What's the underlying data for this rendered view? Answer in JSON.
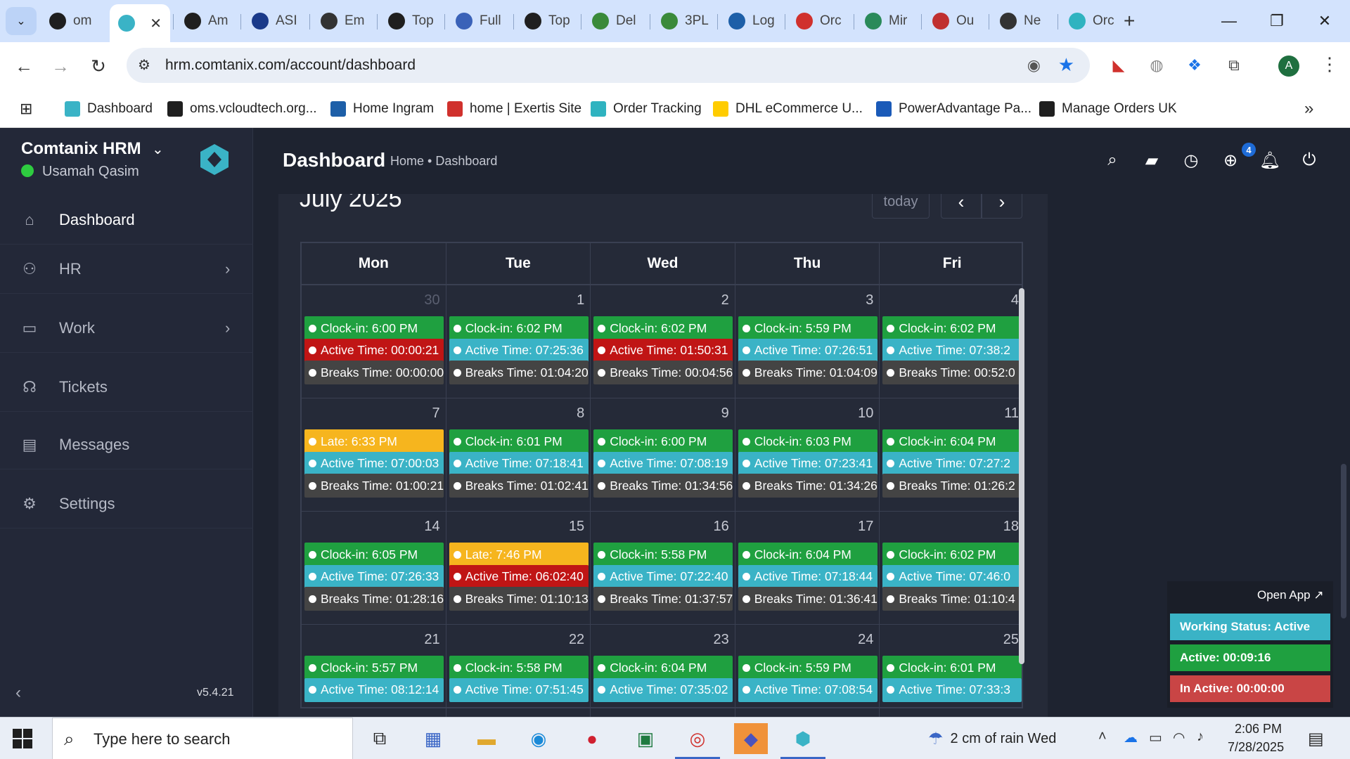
{
  "browser": {
    "tabs": [
      {
        "label": "om",
        "icon": "vcloud-icon",
        "color": "#1f1f1f"
      },
      {
        "label": "",
        "icon": "comtanix-icon",
        "color": "#3ab3c6",
        "active": true
      },
      {
        "label": "Am",
        "icon": "amazon-icon",
        "color": "#1f1f1f"
      },
      {
        "label": "ASI",
        "icon": "asi-icon",
        "color": "#1a3a8a"
      },
      {
        "label": "Em",
        "icon": "openai-icon",
        "color": "#333"
      },
      {
        "label": "Top",
        "icon": "top-icon",
        "color": "#1f1f1f"
      },
      {
        "label": "Full",
        "icon": "box-icon",
        "color": "#3a62b8"
      },
      {
        "label": "Top",
        "icon": "top-icon",
        "color": "#1f1f1f"
      },
      {
        "label": "Del",
        "icon": "truck-icon",
        "color": "#3a8a3a"
      },
      {
        "label": "3PL",
        "icon": "truck-icon",
        "color": "#3a8a3a"
      },
      {
        "label": "Log",
        "icon": "log-icon",
        "color": "#1d5fa8"
      },
      {
        "label": "Orc",
        "icon": "exertis-icon",
        "color": "#d0312d"
      },
      {
        "label": "Mir",
        "icon": "mir-icon",
        "color": "#2a8a5a"
      },
      {
        "label": "Ou",
        "icon": "shein-icon",
        "color": "#c03030"
      },
      {
        "label": "Ne",
        "icon": "openai-icon",
        "color": "#333"
      },
      {
        "label": "Orc",
        "icon": "order-icon",
        "color": "#2fb3c0"
      }
    ],
    "url": "hrm.comtanix.com/account/dashboard",
    "profile_initial": "A",
    "bookmarks": [
      {
        "label": "Dashboard",
        "color": "#3ab3c6"
      },
      {
        "label": "oms.vcloudtech.org...",
        "color": "#1f1f1f"
      },
      {
        "label": "Home Ingram",
        "color": "#1d5fa8"
      },
      {
        "label": "home | Exertis Site",
        "color": "#d0312d"
      },
      {
        "label": "Order Tracking",
        "color": "#2fb3c0"
      },
      {
        "label": "DHL eCommerce U...",
        "color": "#ffcc00"
      },
      {
        "label": "PowerAdvantage Pa...",
        "color": "#1a5ab8"
      },
      {
        "label": "Manage Orders UK",
        "color": "#1f1f1f"
      }
    ]
  },
  "app": {
    "brand": "Comtanix HRM",
    "user": "Usamah Qasim",
    "version": "v5.4.21",
    "nav": [
      {
        "label": "Dashboard",
        "icon": "home-icon",
        "active": true,
        "chevron": false
      },
      {
        "label": "HR",
        "icon": "users-icon",
        "chevron": true
      },
      {
        "label": "Work",
        "icon": "briefcase-icon",
        "chevron": true
      },
      {
        "label": "Tickets",
        "icon": "headset-icon",
        "chevron": false
      },
      {
        "label": "Messages",
        "icon": "message-icon",
        "chevron": false
      },
      {
        "label": "Settings",
        "icon": "gear-icon",
        "chevron": false
      }
    ],
    "page_title": "Dashboard",
    "breadcrumb": "Home • Dashboard",
    "notification_count": "4"
  },
  "calendar": {
    "title": "July 2025",
    "today_label": "today",
    "days_of_week": [
      "Mon",
      "Tue",
      "Wed",
      "Thu",
      "Fri"
    ],
    "weeks": [
      {
        "days": [
          {
            "num": "30",
            "muted": true,
            "events": [
              [
                "green",
                "Clock-in: 6:00 PM"
              ],
              [
                "red",
                "Active Time: 00:00:21"
              ],
              [
                "gray",
                "Breaks Time: 00:00:00"
              ]
            ]
          },
          {
            "num": "1",
            "events": [
              [
                "green",
                "Clock-in: 6:02 PM"
              ],
              [
                "cyan",
                "Active Time: 07:25:36"
              ],
              [
                "gray",
                "Breaks Time: 01:04:20"
              ]
            ]
          },
          {
            "num": "2",
            "events": [
              [
                "green",
                "Clock-in: 6:02 PM"
              ],
              [
                "red",
                "Active Time: 01:50:31"
              ],
              [
                "gray",
                "Breaks Time: 00:04:56"
              ]
            ]
          },
          {
            "num": "3",
            "events": [
              [
                "green",
                "Clock-in: 5:59 PM"
              ],
              [
                "cyan",
                "Active Time: 07:26:51"
              ],
              [
                "gray",
                "Breaks Time: 01:04:09"
              ]
            ]
          },
          {
            "num": "4",
            "events": [
              [
                "green",
                "Clock-in: 6:02 PM"
              ],
              [
                "cyan",
                "Active Time: 07:38:2"
              ],
              [
                "gray",
                "Breaks Time: 00:52:0"
              ]
            ]
          }
        ]
      },
      {
        "days": [
          {
            "num": "7",
            "events": [
              [
                "yellow",
                "Late: 6:33 PM"
              ],
              [
                "cyan",
                "Active Time: 07:00:03"
              ],
              [
                "gray",
                "Breaks Time: 01:00:21"
              ]
            ]
          },
          {
            "num": "8",
            "events": [
              [
                "green",
                "Clock-in: 6:01 PM"
              ],
              [
                "cyan",
                "Active Time: 07:18:41"
              ],
              [
                "gray",
                "Breaks Time: 01:02:41"
              ]
            ]
          },
          {
            "num": "9",
            "events": [
              [
                "green",
                "Clock-in: 6:00 PM"
              ],
              [
                "cyan",
                "Active Time: 07:08:19"
              ],
              [
                "gray",
                "Breaks Time: 01:34:56"
              ]
            ]
          },
          {
            "num": "10",
            "events": [
              [
                "green",
                "Clock-in: 6:03 PM"
              ],
              [
                "cyan",
                "Active Time: 07:23:41"
              ],
              [
                "gray",
                "Breaks Time: 01:34:26"
              ]
            ]
          },
          {
            "num": "11",
            "events": [
              [
                "green",
                "Clock-in: 6:04 PM"
              ],
              [
                "cyan",
                "Active Time: 07:27:2"
              ],
              [
                "gray",
                "Breaks Time: 01:26:2"
              ]
            ]
          }
        ]
      },
      {
        "days": [
          {
            "num": "14",
            "events": [
              [
                "green",
                "Clock-in: 6:05 PM"
              ],
              [
                "cyan",
                "Active Time: 07:26:33"
              ],
              [
                "gray",
                "Breaks Time: 01:28:16"
              ]
            ]
          },
          {
            "num": "15",
            "events": [
              [
                "yellow",
                "Late: 7:46 PM"
              ],
              [
                "red",
                "Active Time: 06:02:40"
              ],
              [
                "gray",
                "Breaks Time: 01:10:13"
              ]
            ]
          },
          {
            "num": "16",
            "events": [
              [
                "green",
                "Clock-in: 5:58 PM"
              ],
              [
                "cyan",
                "Active Time: 07:22:40"
              ],
              [
                "gray",
                "Breaks Time: 01:37:57"
              ]
            ]
          },
          {
            "num": "17",
            "events": [
              [
                "green",
                "Clock-in: 6:04 PM"
              ],
              [
                "cyan",
                "Active Time: 07:18:44"
              ],
              [
                "gray",
                "Breaks Time: 01:36:41"
              ]
            ]
          },
          {
            "num": "18",
            "events": [
              [
                "green",
                "Clock-in: 6:02 PM"
              ],
              [
                "cyan",
                "Active Time: 07:46:0"
              ],
              [
                "gray",
                "Breaks Time: 01:10:4"
              ]
            ]
          }
        ]
      },
      {
        "days": [
          {
            "num": "21",
            "events": [
              [
                "green",
                "Clock-in: 5:57 PM"
              ],
              [
                "cyan",
                "Active Time: 08:12:14"
              ]
            ]
          },
          {
            "num": "22",
            "events": [
              [
                "green",
                "Clock-in: 5:58 PM"
              ],
              [
                "cyan",
                "Active Time: 07:51:45"
              ]
            ]
          },
          {
            "num": "23",
            "events": [
              [
                "green",
                "Clock-in: 6:04 PM"
              ],
              [
                "cyan",
                "Active Time: 07:35:02"
              ]
            ]
          },
          {
            "num": "24",
            "events": [
              [
                "green",
                "Clock-in: 5:59 PM"
              ],
              [
                "cyan",
                "Active Time: 07:08:54"
              ]
            ]
          },
          {
            "num": "25",
            "events": [
              [
                "green",
                "Clock-in: 6:01 PM"
              ],
              [
                "cyan",
                "Active Time: 07:33:3"
              ]
            ]
          }
        ]
      }
    ]
  },
  "widget": {
    "open_app": "Open App ↗",
    "working_status": "Working Status: Active",
    "active": "Active: 00:09:16",
    "inactive": "In Active: 00:00:00"
  },
  "taskbar": {
    "search_placeholder": "Type here to search",
    "weather": "2 cm of rain Wed",
    "time": "2:06 PM",
    "date": "7/28/2025"
  }
}
